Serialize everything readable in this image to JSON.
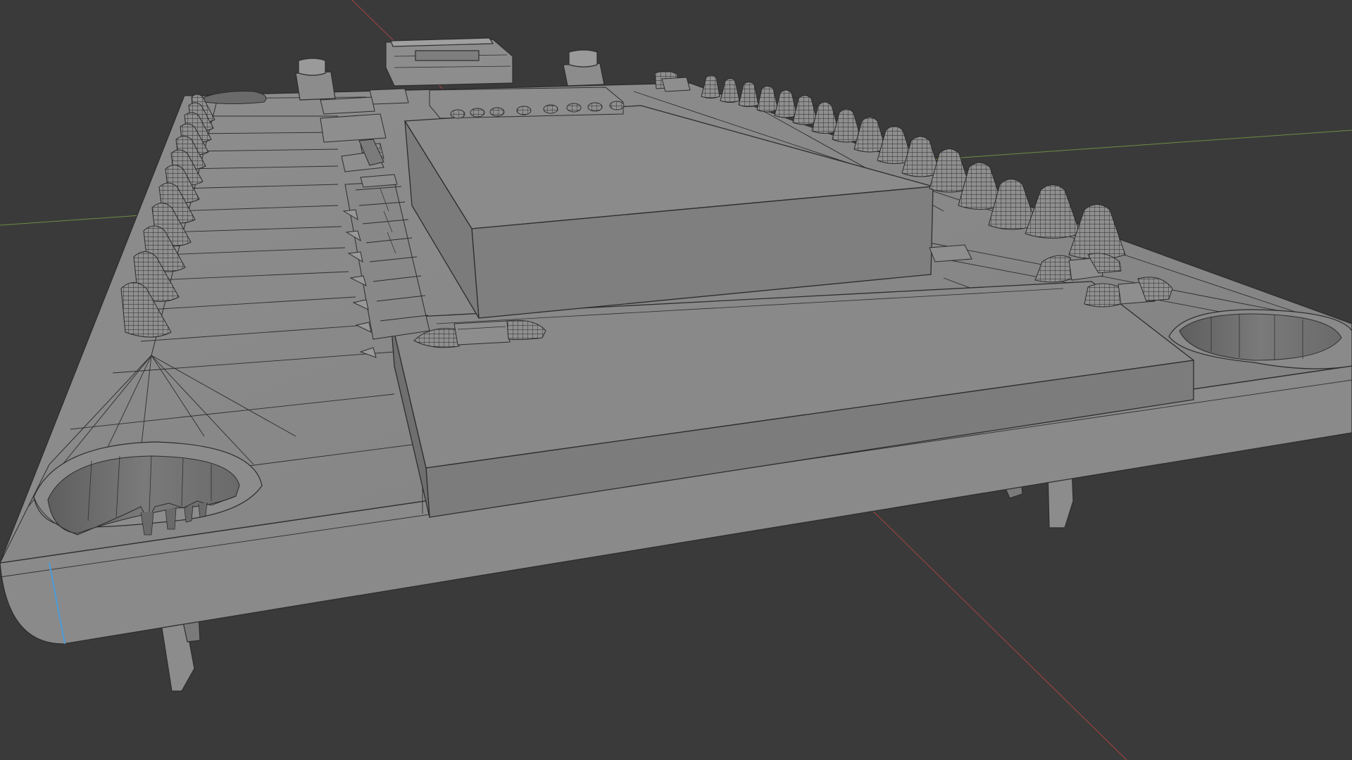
{
  "viewport": {
    "background": "#3a3a3a",
    "axis_x_color": "#c04848",
    "axis_y_color": "#7a9a46",
    "selected_edge_color": "#4a9bd8",
    "mesh_face_color": "#878787",
    "mesh_wire_color": "#2e2e2e"
  },
  "mesh": {
    "object_name": "circuit-board-model",
    "icons": {
      "cone_pin": "cone-mesh-icon",
      "mounting_hole": "mounting-hole-icon",
      "chip_block": "chip-block-icon",
      "smd_component": "smd-component-icon",
      "usb_connector": "usb-connector-icon",
      "push_button": "push-button-icon",
      "leg_pin": "leg-pin-icon"
    }
  }
}
